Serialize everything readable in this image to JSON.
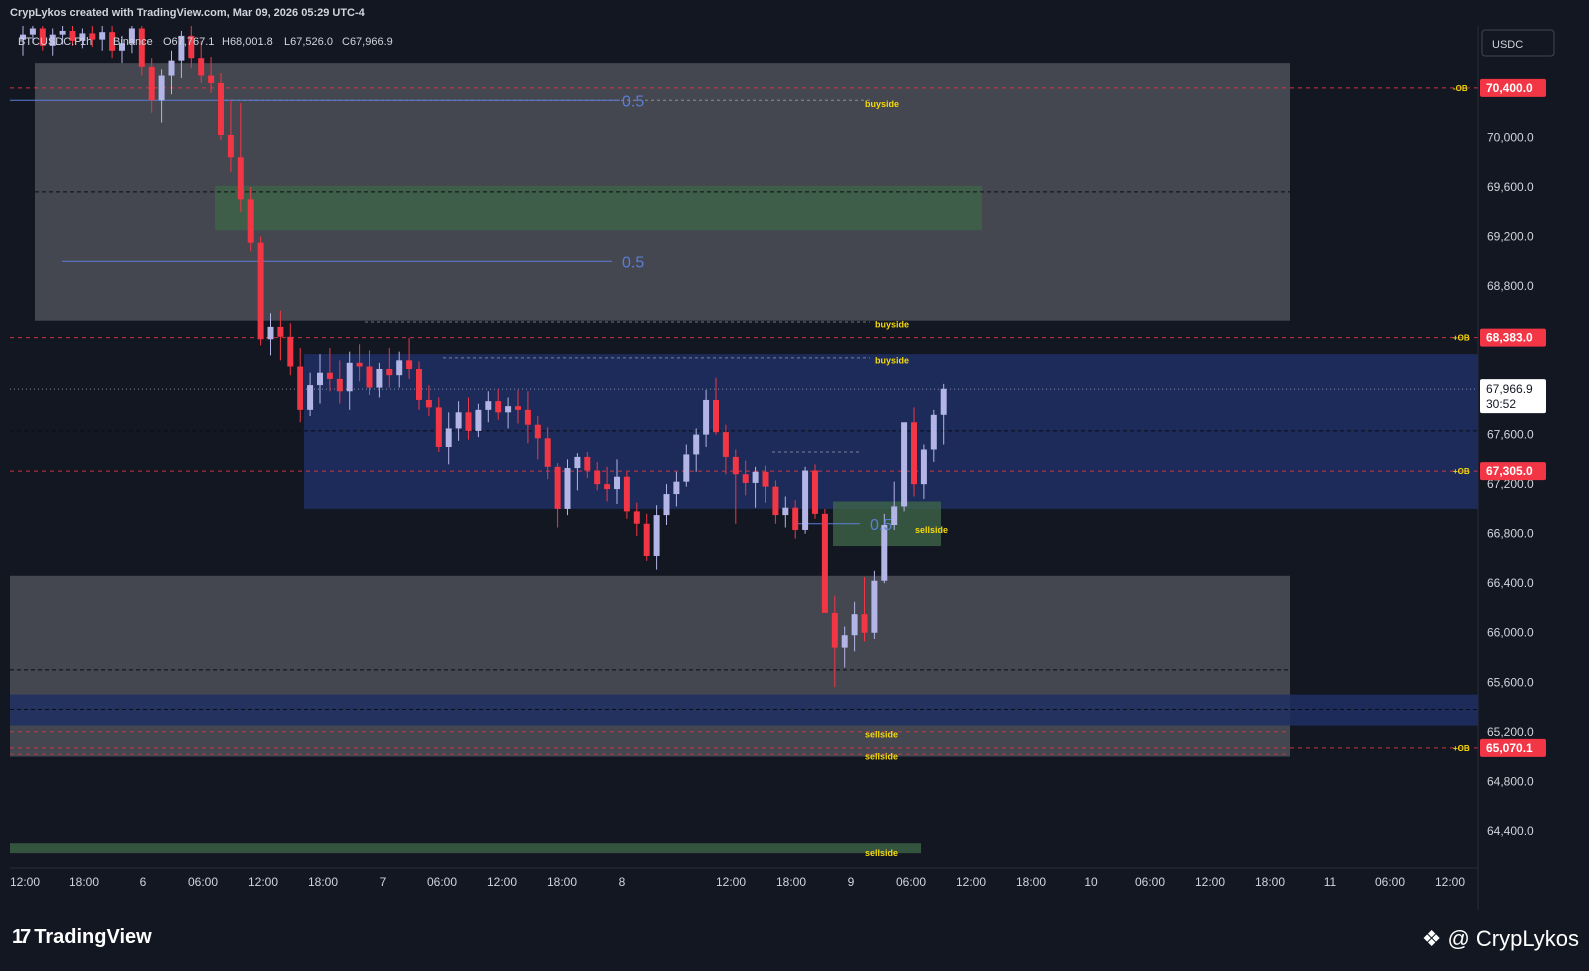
{
  "header": {
    "attribution": "CrypLykos created with TradingView.com, Mar 09, 2026 05:29 UTC-4"
  },
  "legend": {
    "symbol": "BTCUSDC.P",
    "interval": "1h",
    "exchange": "Binance",
    "open": "O67,767.1",
    "high": "H68,001.8",
    "low": "L67,526.0",
    "close": "C67,966.9"
  },
  "currency_button": "USDC",
  "footer": {
    "brand": "TradingView",
    "author": "@ CrypLykos"
  },
  "colors": {
    "background": "#131722",
    "up": "#b2b5e6",
    "down": "#f23645",
    "zone_gray": "#4a4b55",
    "zone_blue": "#1e2f63",
    "zone_green": "#3f6448",
    "level_red": "#f23645",
    "label_yellow": "#f5d90a",
    "fib_blue": "#5b7fd6"
  },
  "chart_data": {
    "type": "candlestick",
    "x_tick_labels": [
      "12:00",
      "18:00",
      "6",
      "06:00",
      "12:00",
      "18:00",
      "7",
      "06:00",
      "12:00",
      "18:00",
      "8",
      "12:00",
      "18:00",
      "9",
      "06:00",
      "12:00",
      "18:00",
      "10",
      "06:00",
      "12:00",
      "18:00",
      "11",
      "06:00",
      "12:00"
    ],
    "y_tick_labels": [
      "70,800.0",
      "70,000.0",
      "69,600.0",
      "69,200.0",
      "68,800.0",
      "67,600.0",
      "67,200.0",
      "66,800.0",
      "66,400.0",
      "66,000.0",
      "65,600.0",
      "65,200.0",
      "64,800.0",
      "64,400.0"
    ],
    "ylim": [
      64100,
      70900
    ],
    "last_price": {
      "value": "67,966.9",
      "countdown": "30:52"
    },
    "price_levels": [
      {
        "value": "70,400.0",
        "tag": "-OB"
      },
      {
        "value": "68,383.0",
        "tag": "+OB"
      },
      {
        "value": "67,305.0",
        "tag": "+OB"
      },
      {
        "value": "65,070.1",
        "tag": "+OB"
      }
    ],
    "liquidity_labels": [
      "buyside",
      "buyside",
      "buyside",
      "sellside",
      "sellside",
      "sellside",
      "sellside"
    ],
    "fib_labels": [
      "0.5",
      "0.5",
      "0.5"
    ],
    "candles": [
      [
        70790,
        70900,
        70660,
        70830
      ],
      [
        70830,
        70900,
        70760,
        70880
      ],
      [
        70880,
        70900,
        70700,
        70740
      ],
      [
        70740,
        70880,
        70660,
        70830
      ],
      [
        70830,
        70900,
        70750,
        70860
      ],
      [
        70860,
        70900,
        70740,
        70780
      ],
      [
        70780,
        70880,
        70720,
        70840
      ],
      [
        70840,
        70900,
        70730,
        70790
      ],
      [
        70790,
        70900,
        70700,
        70850
      ],
      [
        70850,
        70900,
        70640,
        70700
      ],
      [
        70700,
        70820,
        70600,
        70760
      ],
      [
        70760,
        70900,
        70680,
        70880
      ],
      [
        70880,
        70900,
        70500,
        70570
      ],
      [
        70570,
        70640,
        70200,
        70300
      ],
      [
        70300,
        70550,
        70120,
        70500
      ],
      [
        70500,
        70700,
        70350,
        70620
      ],
      [
        70620,
        70860,
        70480,
        70820
      ],
      [
        70820,
        70900,
        70560,
        70640
      ],
      [
        70640,
        70780,
        70440,
        70500
      ],
      [
        70500,
        70650,
        70360,
        70440
      ],
      [
        70440,
        70520,
        69980,
        70020
      ],
      [
        70020,
        70300,
        69720,
        69840
      ],
      [
        69840,
        70280,
        69400,
        69500
      ],
      [
        69500,
        69600,
        69080,
        69150
      ],
      [
        69150,
        69200,
        68320,
        68370
      ],
      [
        68370,
        68580,
        68240,
        68470
      ],
      [
        68470,
        68600,
        68200,
        68390
      ],
      [
        68390,
        68500,
        68080,
        68150
      ],
      [
        68150,
        68300,
        67700,
        67800
      ],
      [
        67800,
        68100,
        67750,
        68000
      ],
      [
        68000,
        68250,
        67850,
        68100
      ],
      [
        68100,
        68300,
        67950,
        68050
      ],
      [
        68050,
        68200,
        67850,
        67950
      ],
      [
        67950,
        68270,
        67800,
        68180
      ],
      [
        68180,
        68330,
        68030,
        68150
      ],
      [
        68150,
        68280,
        67920,
        67980
      ],
      [
        67980,
        68180,
        67900,
        68130
      ],
      [
        68130,
        68300,
        67980,
        68080
      ],
      [
        68080,
        68270,
        67980,
        68200
      ],
      [
        68200,
        68380,
        68050,
        68130
      ],
      [
        68130,
        68190,
        67800,
        67880
      ],
      [
        67880,
        68000,
        67750,
        67820
      ],
      [
        67820,
        67900,
        67460,
        67500
      ],
      [
        67500,
        67780,
        67360,
        67650
      ],
      [
        67650,
        67870,
        67550,
        67780
      ],
      [
        67780,
        67900,
        67560,
        67630
      ],
      [
        67630,
        67850,
        67580,
        67800
      ],
      [
        67800,
        67950,
        67700,
        67870
      ],
      [
        67870,
        67970,
        67720,
        67780
      ],
      [
        67780,
        67900,
        67650,
        67830
      ],
      [
        67830,
        67960,
        67690,
        67800
      ],
      [
        67800,
        67950,
        67530,
        67680
      ],
      [
        67680,
        67750,
        67400,
        67570
      ],
      [
        67570,
        67660,
        67240,
        67340
      ],
      [
        67340,
        67370,
        66850,
        67000
      ],
      [
        67000,
        67400,
        66950,
        67330
      ],
      [
        67330,
        67450,
        67150,
        67420
      ],
      [
        67420,
        67460,
        67250,
        67310
      ],
      [
        67310,
        67380,
        67150,
        67200
      ],
      [
        67200,
        67340,
        67060,
        67160
      ],
      [
        67160,
        67400,
        67040,
        67260
      ],
      [
        67260,
        67300,
        66920,
        66980
      ],
      [
        66980,
        67050,
        66780,
        66880
      ],
      [
        66880,
        66960,
        66580,
        66620
      ],
      [
        66620,
        67030,
        66510,
        66950
      ],
      [
        66950,
        67200,
        66870,
        67120
      ],
      [
        67120,
        67300,
        67020,
        67220
      ],
      [
        67220,
        67520,
        67180,
        67440
      ],
      [
        67440,
        67650,
        67300,
        67600
      ],
      [
        67600,
        67960,
        67500,
        67880
      ],
      [
        67880,
        68060,
        67600,
        67620
      ],
      [
        67620,
        67680,
        67280,
        67420
      ],
      [
        67420,
        67480,
        66880,
        67280
      ],
      [
        67280,
        67390,
        67110,
        67210
      ],
      [
        67210,
        67340,
        67010,
        67300
      ],
      [
        67300,
        67350,
        67050,
        67180
      ],
      [
        67180,
        67230,
        66880,
        66950
      ],
      [
        66950,
        67100,
        66850,
        67010
      ],
      [
        67010,
        67070,
        66760,
        66830
      ],
      [
        66830,
        67340,
        66800,
        67310
      ],
      [
        67310,
        67360,
        66920,
        66960
      ],
      [
        66960,
        67000,
        66490,
        66160
      ],
      [
        66160,
        66300,
        65560,
        65880
      ],
      [
        65880,
        66050,
        65720,
        65980
      ],
      [
        65980,
        66250,
        65850,
        66150
      ],
      [
        66150,
        66450,
        65930,
        66000
      ],
      [
        66000,
        66500,
        65950,
        66420
      ],
      [
        66420,
        66960,
        66400,
        66870
      ],
      [
        66870,
        67220,
        66830,
        67020
      ],
      [
        67020,
        67480,
        66980,
        67700
      ],
      [
        67700,
        67820,
        67100,
        67200
      ],
      [
        67200,
        67520,
        67080,
        67480
      ],
      [
        67480,
        67800,
        67380,
        67760
      ],
      [
        67760,
        68010,
        67520,
        67970
      ]
    ],
    "zones": [
      {
        "kind": "gray",
        "top": 70600,
        "bottom": 68520
      },
      {
        "kind": "green",
        "top": 69610,
        "bottom": 69250
      },
      {
        "kind": "blue",
        "top": 68250,
        "bottom": 67000
      },
      {
        "kind": "green",
        "top": 67060,
        "bottom": 66700
      },
      {
        "kind": "gray",
        "top": 66460,
        "bottom": 65000
      },
      {
        "kind": "blue",
        "top": 65500,
        "bottom": 65250
      },
      {
        "kind": "green",
        "top": 64300,
        "bottom": 64220
      }
    ]
  }
}
